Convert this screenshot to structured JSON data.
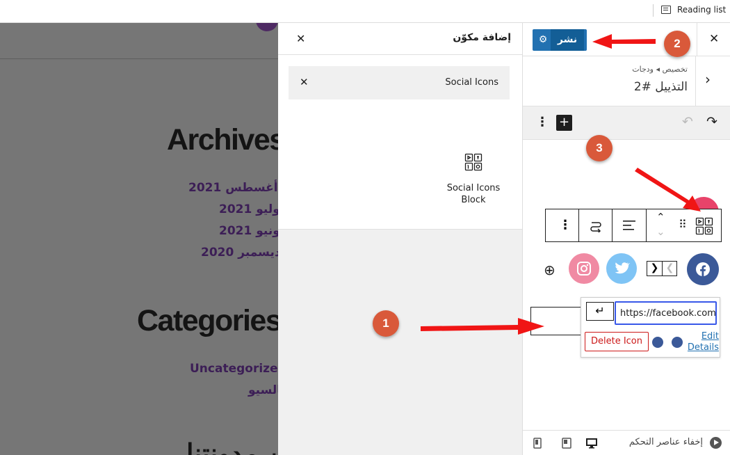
{
  "browser": {
    "reading_list_label": "Reading list"
  },
  "preview": {
    "archives_heading": "Archives",
    "archive_links": [
      "أغسطس 2021",
      "يوليو 2021",
      "يونيو 2021",
      "ديسمبر 2020"
    ],
    "categories_heading": "Categories",
    "category_links": [
      "Uncategorized",
      "بالسيو"
    ],
    "bottom_heading": "عن مدونتنا"
  },
  "inserter": {
    "title": "إضافة مكوّن",
    "close_icon": "close-icon",
    "search_value": "Social Icons",
    "result_block_label": "Social Icons Block",
    "result_icon": "social-icons-block-icon"
  },
  "sidebar": {
    "publish_label": "نشر",
    "publish_gear_icon": "gear-icon",
    "close_icon": "close-icon",
    "breadcrumb": "تخصيص ◂ ودجات",
    "panel_title": "التذييل #2",
    "toolbar": {
      "options_icon": "more-vertical-icon",
      "add_icon": "plus-icon",
      "undo_icon": "undo-icon",
      "redo_icon": "redo-icon"
    },
    "block_toolbar": [
      "social-icons-block-icon",
      "drag-handle-icon",
      "move-up-down-icon",
      "align-icon",
      "transform-icon",
      "more-vertical-icon"
    ],
    "social_icons": [
      {
        "name": "facebook",
        "color": "#3b5998"
      },
      {
        "name": "twitter",
        "color": "#7fc4f5"
      },
      {
        "name": "instagram",
        "color": "#f08aa3"
      }
    ],
    "link_popover": {
      "url_value": "https://facebook.com",
      "delete_label": "Delete Icon",
      "edit_label": "Edit Details"
    },
    "footer": {
      "hide_controls_label": "إخفاء عناصر التحكم"
    }
  },
  "annotations": {
    "badges": [
      "1",
      "2",
      "3"
    ],
    "color": "#d9593a",
    "arrow_color": "#f01515"
  }
}
